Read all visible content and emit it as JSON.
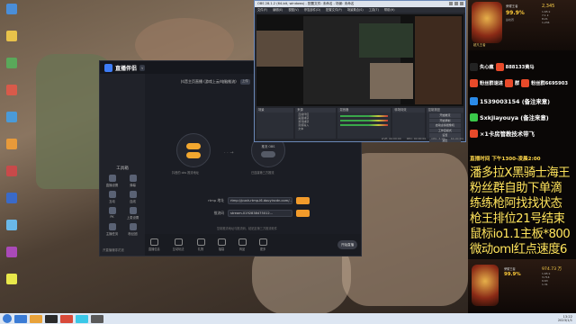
{
  "desktop": {
    "icons": [
      {
        "label": "",
        "color": "#4a8ed8"
      },
      {
        "label": "",
        "color": "#e8c24a"
      },
      {
        "label": "",
        "color": "#5aa85a"
      },
      {
        "label": "",
        "color": "#d85a4a"
      },
      {
        "label": "",
        "color": "#4a9ad8"
      },
      {
        "label": "",
        "color": "#e89a3a"
      },
      {
        "label": "",
        "color": "#c84a4a"
      },
      {
        "label": "",
        "color": "#3a6ac8"
      },
      {
        "label": "",
        "color": "#6ab8e8"
      },
      {
        "label": "",
        "color": "#aa4ab8"
      },
      {
        "label": "",
        "color": "#e8e84a"
      }
    ]
  },
  "helper": {
    "brand": "直播伴侣",
    "mode": "抖音主页直播 (游戏上云/电脑推流)",
    "mode_badge": "上传",
    "device_left": "推流",
    "device_right": "推流 OBS",
    "device_left_caption": "抖音的 obs 推流地址",
    "device_right_caption": "已连接第三方推流",
    "rtmp_label": "rtmp 地址",
    "rtmp_value": "rtmp://push-rtmp-l6.douyincdn.com/...",
    "key_label": "推流码",
    "key_value": "stream-0192838475012...",
    "note": "复制推流地址与推流码，粘贴至第三方推流软件",
    "tools_title": "工具箱",
    "tools": [
      {
        "label": "直播设置"
      },
      {
        "label": "弹幕"
      },
      {
        "label": "互动"
      },
      {
        "label": "连线"
      },
      {
        "label": "PK"
      },
      {
        "label": "上麦设置"
      },
      {
        "label": "主播任务"
      },
      {
        "label": "粉丝团"
      }
    ],
    "side_footer": "开直播赚零花钱",
    "bottom_actions": [
      {
        "label": "直播信息"
      },
      {
        "label": "互动玩法"
      },
      {
        "label": "礼物"
      },
      {
        "label": "福袋"
      },
      {
        "label": "商品"
      },
      {
        "label": "更多"
      }
    ],
    "go_live": "开始直播"
  },
  "obs": {
    "title": "OBS 28.1.2 (64-bit, windows) - 配置文件: 未命名 - 场景: 未命名",
    "menu": [
      "文件(F)",
      "编辑(E)",
      "视图(V)",
      "停靠部件(D)",
      "配置文件(P)",
      "场景集合(S)",
      "工具(T)",
      "帮助(H)"
    ],
    "docks": {
      "scenes_title": "场景",
      "sources_title": "来源",
      "sources": [
        "直播伴侣",
        "画面捕获",
        "游戏捕获",
        "音频输入",
        "文本"
      ],
      "mixer_title": "混音器",
      "transitions_title": "转场特效",
      "controls_title": "控制按钮",
      "controls": [
        "开始推流",
        "开始录制",
        "启动虚拟摄像机",
        "工作室模式",
        "设置",
        "退出"
      ]
    },
    "status": [
      "LIVE: 00:00:00",
      "REC: 00:00:00",
      "CPU: 3.1%",
      "60.00 fps"
    ]
  },
  "overlay": {
    "rank_title": "荣耀王者",
    "rank_value": "99.9%",
    "rank_sub": "巅峰赛",
    "stats": [
      "1.65 k",
      "7.1 k",
      "8:21",
      "1,234"
    ],
    "stats_big": "2,345",
    "badge_label": "超凡王者",
    "contacts": [
      {
        "text": "失心瘋",
        "color": "#ffffff",
        "icon": "tiktok-icon",
        "icon_color": "#222222"
      },
      {
        "text": "888133黄马",
        "color": "#ffffff",
        "icon": "flame-icon",
        "icon_color": "#e84a2a"
      },
      {
        "text": "粉丝群速进",
        "color": "#ffffff",
        "icon": "group-icon",
        "icon_color": "#e84a2a"
      },
      {
        "text": "群",
        "color": "#ffffff",
        "icon": "group-icon",
        "icon_color": "#e84a2a"
      },
      {
        "text": "粉丝群6695903",
        "color": "#ffffff",
        "icon": "group-icon",
        "icon_color": "#e84a2a"
      },
      {
        "text": "1539003154 (备注来意)",
        "color": "#ffffff",
        "icon": "qq-icon",
        "icon_color": "#2a8ae8"
      },
      {
        "text": "Sxkjiayouya (备注来意)",
        "color": "#ffffff",
        "icon": "wechat-icon",
        "icon_color": "#3ac84a"
      },
      {
        "text": "×1卡房管教技术带飞",
        "color": "#ffffff",
        "icon": "rocket-icon",
        "icon_color": "#e84a2a"
      }
    ],
    "live_time": "直播时间 下午1300-凌晨2:00",
    "big_lines": [
      "潘多拉X黑骑士海王",
      "粉丝群自助下单滴",
      "练练枪阿找找状态",
      "枪王排位21号结束",
      "鼠标io1.1主板*800",
      "微动oml红点速度6"
    ],
    "bottom_rank_title": "荣耀王者",
    "bottom_rank_value": "99.9%",
    "bottom_stats": [
      "1.65 k",
      "3,714",
      "9.63",
      "1.31"
    ],
    "bottom_stats_big": "974.73 万",
    "bottom_badge_label": "超凡王者"
  },
  "taskbar": {
    "apps": [
      {
        "color": "#3a7bd5"
      },
      {
        "color": "#e8a23a"
      },
      {
        "color": "#2a2a2a"
      },
      {
        "color": "#d84a3a"
      },
      {
        "color": "#3ac8e8"
      },
      {
        "color": "#5a5a5a"
      }
    ],
    "time": "13:22",
    "date": "2023/1/1"
  }
}
